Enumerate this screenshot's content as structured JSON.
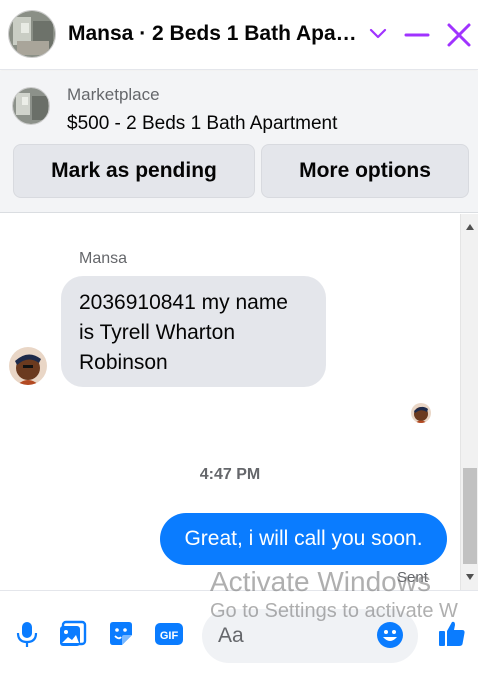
{
  "header": {
    "title": "Mansa · 2 Beds 1 Bath Apa…",
    "accent_color": "#a033ff"
  },
  "marketplace": {
    "label": "Marketplace",
    "listing": "$500 - 2 Beds 1 Bath Apartment",
    "mark_pending_label": "Mark as pending",
    "more_options_label": "More options"
  },
  "thread": {
    "sender_name": "Mansa",
    "incoming_message": "2036910841 my name is Tyrell Wharton Robinson",
    "timestamp": "4:47 PM",
    "outgoing_message": "Great, i will call you soon.",
    "status": "Sent",
    "outgoing_color": "#0a7cff"
  },
  "composer": {
    "placeholder": "Aa",
    "icon_color": "#0a7cff"
  },
  "watermark": {
    "line1": "Activate Windows",
    "line2": "Go to Settings to activate W"
  }
}
